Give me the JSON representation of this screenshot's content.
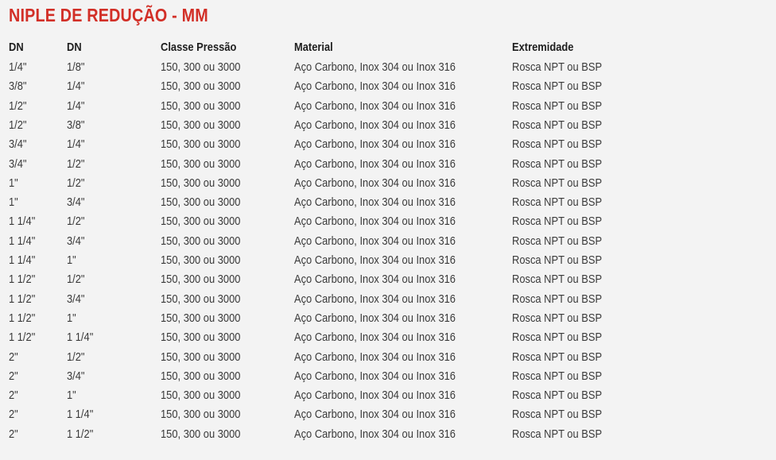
{
  "title": "NIPLE DE REDUÇÃO - MM",
  "headers": [
    "DN",
    "DN",
    "Classe Pressão",
    "Material",
    "Extremidade"
  ],
  "rows": [
    [
      "1/4\"",
      "1/8\"",
      "150, 300 ou 3000",
      "Aço Carbono, Inox 304 ou Inox 316",
      "Rosca NPT ou BSP"
    ],
    [
      "3/8\"",
      "1/4\"",
      "150, 300 ou 3000",
      "Aço Carbono, Inox 304 ou Inox 316",
      "Rosca NPT ou BSP"
    ],
    [
      "1/2\"",
      "1/4\"",
      "150, 300 ou 3000",
      "Aço Carbono, Inox 304 ou Inox 316",
      "Rosca NPT ou BSP"
    ],
    [
      "1/2\"",
      "3/8\"",
      "150, 300 ou 3000",
      "Aço Carbono, Inox 304 ou Inox 316",
      "Rosca NPT ou BSP"
    ],
    [
      "3/4\"",
      "1/4\"",
      "150, 300 ou 3000",
      "Aço Carbono, Inox 304 ou Inox 316",
      "Rosca NPT ou BSP"
    ],
    [
      "3/4\"",
      "1/2\"",
      "150, 300 ou 3000",
      "Aço Carbono, Inox 304 ou Inox 316",
      "Rosca NPT ou BSP"
    ],
    [
      "1\"",
      "1/2\"",
      "150, 300 ou 3000",
      "Aço Carbono, Inox 304 ou Inox 316",
      "Rosca NPT ou BSP"
    ],
    [
      "1\"",
      "3/4\"",
      "150, 300 ou 3000",
      "Aço Carbono, Inox 304 ou Inox 316",
      "Rosca NPT ou BSP"
    ],
    [
      "1 1/4\"",
      "1/2\"",
      "150, 300 ou 3000",
      "Aço Carbono, Inox 304 ou Inox 316",
      "Rosca NPT ou BSP"
    ],
    [
      "1 1/4\"",
      "3/4\"",
      "150, 300 ou 3000",
      "Aço Carbono, Inox 304 ou Inox 316",
      "Rosca NPT ou BSP"
    ],
    [
      "1 1/4\"",
      "1\"",
      "150, 300 ou 3000",
      "Aço Carbono, Inox 304 ou Inox 316",
      "Rosca NPT ou BSP"
    ],
    [
      "1 1/2\"",
      "1/2\"",
      "150, 300 ou 3000",
      "Aço Carbono, Inox 304 ou Inox 316",
      "Rosca NPT ou BSP"
    ],
    [
      "1 1/2\"",
      "3/4\"",
      "150, 300 ou 3000",
      "Aço Carbono, Inox 304 ou Inox 316",
      "Rosca NPT ou BSP"
    ],
    [
      "1 1/2\"",
      "1\"",
      "150, 300 ou 3000",
      "Aço Carbono, Inox 304 ou Inox 316",
      "Rosca NPT ou BSP"
    ],
    [
      "1 1/2\"",
      "1 1/4\"",
      "150, 300 ou 3000",
      "Aço Carbono, Inox 304 ou Inox 316",
      "Rosca NPT ou BSP"
    ],
    [
      "2\"",
      "1/2\"",
      "150, 300 ou 3000",
      "Aço Carbono, Inox 304 ou Inox 316",
      "Rosca NPT ou BSP"
    ],
    [
      "2\"",
      "3/4\"",
      "150, 300 ou 3000",
      "Aço Carbono, Inox 304 ou Inox 316",
      "Rosca NPT ou BSP"
    ],
    [
      "2\"",
      "1\"",
      "150, 300 ou 3000",
      "Aço Carbono, Inox 304 ou Inox 316",
      "Rosca NPT ou BSP"
    ],
    [
      "2\"",
      "1 1/4\"",
      "150, 300 ou 3000",
      "Aço Carbono, Inox 304 ou Inox 316",
      "Rosca NPT ou BSP"
    ],
    [
      "2\"",
      "1 1/2\"",
      "150, 300 ou 3000",
      "Aço Carbono, Inox 304 ou Inox 316",
      "Rosca NPT ou BSP"
    ]
  ]
}
